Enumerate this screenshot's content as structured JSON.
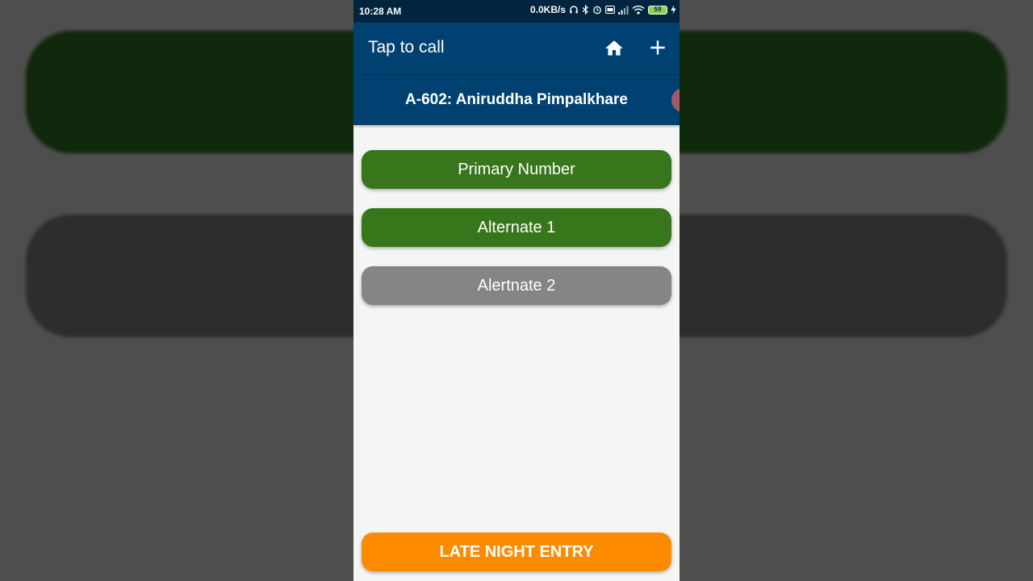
{
  "status_bar": {
    "time": "10:28 AM",
    "network_speed": "0.0KB/s",
    "battery_level": "59",
    "icons": [
      "headphones-icon",
      "bluetooth-icon",
      "alarm-icon",
      "volte-icon",
      "signal-icon",
      "wifi-icon",
      "battery-icon",
      "charging-icon"
    ]
  },
  "app_bar": {
    "title": "Tap to call",
    "actions": [
      "home-icon",
      "add-icon"
    ]
  },
  "flat_header": {
    "title": "A-602: Aniruddha Pimpalkhare"
  },
  "call_buttons": [
    {
      "label": "Primary Number",
      "color": "#37761a"
    },
    {
      "label": "Alternate 1",
      "color": "#37761a"
    },
    {
      "label": "Alertnate 2",
      "color": "#858684"
    }
  ],
  "late_night_button": {
    "label": "LATE NIGHT ENTRY",
    "color": "#fd8b00"
  },
  "colors": {
    "header": "#004171",
    "status_bar": "#01243f",
    "background": "#f4f6f3"
  }
}
